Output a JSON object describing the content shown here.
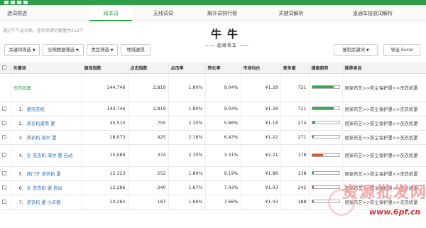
{
  "colors": {
    "brand_green": "#2e9e47",
    "link_blue": "#2e6fb5",
    "bar_green": "#36a852",
    "bar_red": "#e0522f"
  },
  "tabs": [
    {
      "label": "选词预选",
      "active": false
    },
    {
      "label": "同本词",
      "active": true
    },
    {
      "label": "无线词词",
      "active": false
    },
    {
      "label": "飙升词排行榜",
      "active": false
    },
    {
      "label": "关键词解析",
      "active": false
    },
    {
      "label": "直通车投放词解析",
      "active": false
    }
  ],
  "hint": "通过牛牛选词后，查到关键词数量为212个",
  "brand": {
    "title": "牛牛",
    "subtitle": "—— 超级快车 ——"
  },
  "toolbar": {
    "keyword_filter": "关键词筛选",
    "match_filter": "全网数据筛选",
    "category_filter": "类目筛选",
    "region_view": "地域透视",
    "copy_keywords": "复制关键词",
    "export_excel": "导出 Excel"
  },
  "table": {
    "headers": [
      "关键词",
      "展现指数",
      "点击指数",
      "点击率",
      "转化率",
      "市场均价",
      "竞争度",
      "搜索趋势",
      "推荐类目"
    ],
    "group_row": {
      "keyword": "洗衣机器",
      "impressions": "144,746",
      "clicks": "2,819",
      "ctr": "1.80%",
      "cvr": "9.04%",
      "avg_price": "¥1.28",
      "competition": "721",
      "trend": 0.8,
      "trend_color": "green",
      "category": "居家布艺>>防尘保护罩>>洗衣机罩"
    },
    "rows": [
      {
        "no": "1.",
        "keyword": "罩洗衣机",
        "impressions": "144,746",
        "clicks": "2,819",
        "ctr": "1.80%",
        "cvr": "9.04%",
        "avg_price": "¥1.28",
        "competition": "721",
        "trend": 0.8,
        "trend_color": "green",
        "category": "居家布艺>>防尘保护罩>>洗衣机罩"
      },
      {
        "no": "2.",
        "keyword": "洗衣机滚筒 罩",
        "impressions": "30,510",
        "clicks": "755",
        "ctr": "2.30%",
        "cvr": "5.66%",
        "avg_price": "¥1.18",
        "competition": "274",
        "trend": 0.1,
        "trend_color": "green",
        "category": "居家布艺>>防尘保护罩>>洗衣机罩"
      },
      {
        "no": "3.",
        "keyword": "洗衣机 海尔 罩",
        "impressions": "18,073",
        "clicks": "425",
        "ctr": "2.18%",
        "cvr": "6.43%",
        "avg_price": "¥1.22",
        "competition": "271",
        "trend": 0.05,
        "trend_color": "green",
        "category": "居家布艺>>防尘保护罩>>洗衣机罩"
      },
      {
        "no": "4.",
        "keyword": "全 洗衣机 海尔 罩 自动",
        "impressions": "15,089",
        "clicks": "374",
        "ctr": "2.30%",
        "cvr": "3.31%",
        "avg_price": "¥2.21",
        "competition": "176",
        "trend": 0.4,
        "trend_color": "red",
        "category": "居家布艺>>防尘保护罩>>洗衣机罩"
      },
      {
        "no": "5.",
        "keyword": "西门子 洗衣机 罩",
        "impressions": "12,323",
        "clicks": "252",
        "ctr": "1.89%",
        "cvr": "9.19%",
        "avg_price": "¥1.88",
        "competition": "138",
        "trend": 0.05,
        "trend_color": "green",
        "category": "居家布艺>>防尘保护罩>>洗衣机罩"
      },
      {
        "no": "6.",
        "keyword": "全 洗衣机 罩 自动",
        "impressions": "13,286",
        "clicks": "240",
        "ctr": "1.67%",
        "cvr": "7.43%",
        "avg_price": "¥1.03",
        "competition": "242",
        "trend": 0.05,
        "trend_color": "red",
        "category": "居家布艺>>防尘保护罩>>洗衣机罩"
      },
      {
        "no": "7.",
        "keyword": "洗衣机 罩 小天鹅",
        "impressions": "10,262",
        "clicks": "187",
        "ctr": "1.69%",
        "cvr": "7.66%",
        "avg_price": "¥1.03",
        "competition": "188",
        "trend": 0.05,
        "trend_color": "green",
        "category": "居家布艺>>防尘保护罩>>洗衣机罩"
      }
    ]
  },
  "watermark": {
    "text": "资源批发网",
    "site": "www.6pf.cn"
  }
}
